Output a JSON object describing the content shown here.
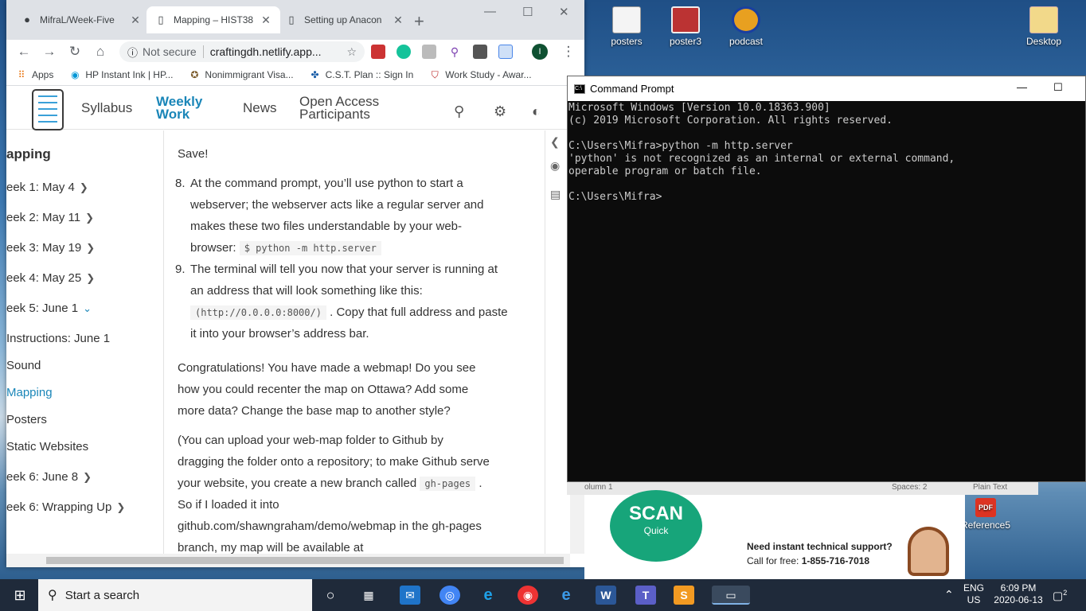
{
  "desktop": {
    "icons": [
      {
        "label": "posters"
      },
      {
        "label": "poster3"
      },
      {
        "label": "podcast"
      },
      {
        "label": "Desktop"
      },
      {
        "label": "Reference5"
      }
    ]
  },
  "browser": {
    "tabs": [
      {
        "label": "MifraL/Week-Five"
      },
      {
        "label": "Mapping – HIST38"
      },
      {
        "label": "Setting up Anacon"
      }
    ],
    "address": {
      "security": "Not secure",
      "url": "craftingdh.netlify.app..."
    },
    "profile_initial": "I",
    "bookmarks": [
      {
        "label": "Apps"
      },
      {
        "label": "HP Instant Ink | HP..."
      },
      {
        "label": "Nonimmigrant Visa..."
      },
      {
        "label": "C.S.T. Plan :: Sign In"
      },
      {
        "label": "Work Study - Awar..."
      }
    ]
  },
  "site": {
    "nav": {
      "syllabus": "Syllabus",
      "weekly_1": "Weekly",
      "weekly_2": "Work",
      "news": "News",
      "oap_1": "Open Access",
      "oap_2": "Participants"
    },
    "sidebar": {
      "title": "apping",
      "items": [
        {
          "label": "eek 1: May 4"
        },
        {
          "label": "eek 2: May 11"
        },
        {
          "label": "eek 3: May 19"
        },
        {
          "label": "eek 4: May 25"
        },
        {
          "label": "eek 5: June 1"
        },
        {
          "label": "Instructions: June 1"
        },
        {
          "label": "Sound"
        },
        {
          "label": "Mapping"
        },
        {
          "label": "Posters"
        },
        {
          "label": "Static Websites"
        },
        {
          "label": "eek 6: June 8"
        },
        {
          "label": "eek 6: Wrapping Up"
        }
      ]
    },
    "content": {
      "save": "Save!",
      "step8_num": "8.",
      "step8_l1": "At the command prompt, you’ll use python to start a",
      "step8_l2": "webserver; the webserver acts like a regular server and",
      "step8_l3": "makes these two files understandable by your web-",
      "step8_l4": "browser:",
      "step8_code": "$ python -m http.server",
      "step9_num": "9.",
      "step9_l1": "The terminal will tell you now that your server is running at",
      "step9_l2": "an address that will look something like this:",
      "step9_code": "(http://0.0.0.0:8000/)",
      "step9_l3": ". Copy that full address and paste",
      "step9_l4": "it into your browser’s address bar.",
      "congrats_l1": "Congratulations! You have made a webmap! Do you see",
      "congrats_l2": "how you could recenter the map on Ottawa? Add some",
      "congrats_l3": "more data? Change the base map to another style?",
      "upload_l1": "(You can upload your web-map folder to Github by",
      "upload_l2": "dragging the folder onto a repository; to make Github serve",
      "upload_l3": "your website, you create a new branch called",
      "upload_code": "gh-pages",
      "upload_l3b": ".",
      "upload_l4": "So if I loaded it into",
      "upload_l5": "github.com/shawngraham/demo/webmap in the gh-pages",
      "upload_l6": "branch, my map will be available at"
    }
  },
  "cmd": {
    "title": "Command Prompt",
    "lines": [
      "Microsoft Windows [Version 10.0.18363.900]",
      "(c) 2019 Microsoft Corporation. All rights reserved.",
      "",
      "C:\\Users\\Mifra>python -m http.server",
      "'python' is not recognized as an internal or external command,",
      "operable program or batch file.",
      "",
      "C:\\Users\\Mifra>"
    ]
  },
  "editor_status": {
    "left": "olumn 1",
    "spaces": "Spaces: 2",
    "syntax": "Plain Text"
  },
  "ad": {
    "scan_big": "SCAN",
    "scan_small": "Quick",
    "support_title": "Need instant technical support?",
    "support_call": "Call for free:",
    "support_phone": "1-855-716-7018"
  },
  "taskbar": {
    "search_placeholder": "Start a search",
    "lang_1": "ENG",
    "lang_2": "US",
    "time": "6:09 PM",
    "date": "2020-06-13",
    "notif_count": "2"
  },
  "colors": {
    "accent": "#1a86b8",
    "cmd_bg": "#0c0c0c",
    "scan_green": "#17a57a"
  }
}
